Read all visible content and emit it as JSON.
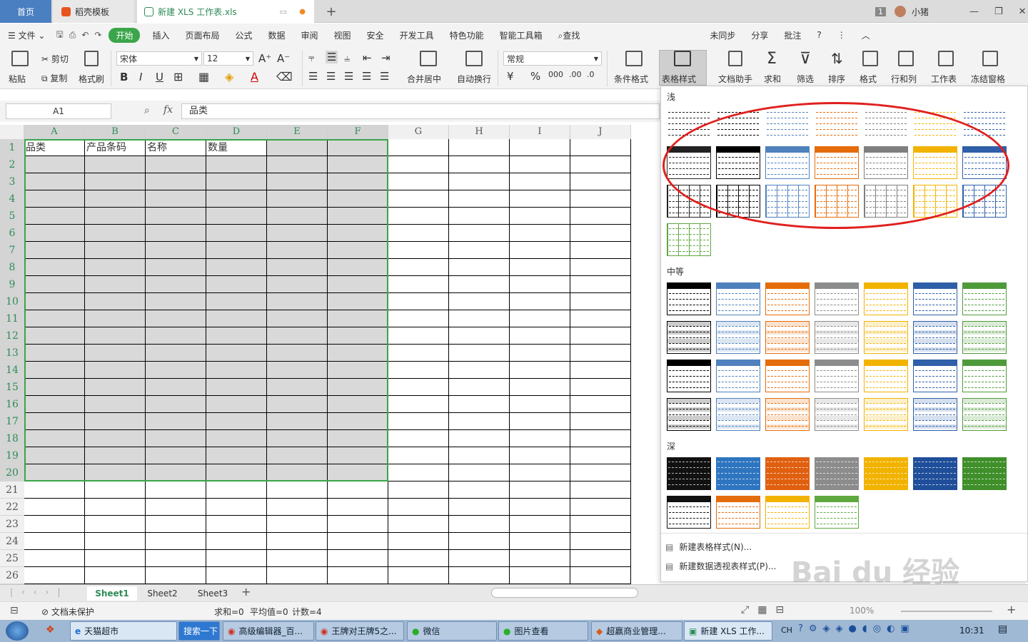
{
  "tabs": {
    "home": "首页",
    "daoke": "稻壳模板",
    "file": "新建 XLS 工作表.xls",
    "count_badge": "1",
    "user": "小猪"
  },
  "menu": {
    "file": "文件",
    "items": [
      "开始",
      "插入",
      "页面布局",
      "公式",
      "数据",
      "审阅",
      "视图",
      "安全",
      "开发工具",
      "特色功能",
      "智能工具箱"
    ],
    "search": "查找",
    "right": [
      "未同步",
      "分享",
      "批注"
    ]
  },
  "ribbon": {
    "paste": "粘贴",
    "cut": "剪切",
    "copy": "复制",
    "format_painter": "格式刷",
    "font": "宋体",
    "font_size": "12",
    "merge": "合并居中",
    "wrap": "自动换行",
    "number_format": "常规",
    "cond_format": "条件格式",
    "table_style": "表格样式",
    "doc_helper": "文档助手",
    "sum": "求和",
    "filter": "筛选",
    "sort": "排序",
    "format": "格式",
    "rowcol": "行和列",
    "sheet": "工作表",
    "freeze": "冻结窗格"
  },
  "formula": {
    "cell_ref": "A1",
    "fx": "fx",
    "content": "品类"
  },
  "grid": {
    "columns": [
      "A",
      "B",
      "C",
      "D",
      "E",
      "F",
      "G",
      "H",
      "I",
      "J"
    ],
    "rows": [
      "1",
      "2",
      "3",
      "4",
      "5",
      "6",
      "7",
      "8",
      "9",
      "10",
      "11",
      "12",
      "13",
      "14",
      "15",
      "16",
      "17",
      "18",
      "19",
      "20",
      "21",
      "22",
      "23",
      "24",
      "25",
      "26"
    ],
    "headers": [
      "品类",
      "产品条码",
      "名称",
      "数量"
    ]
  },
  "gallery": {
    "light": "浅",
    "medium": "中等",
    "dark": "深",
    "new_table_style": "新建表格样式(N)...",
    "new_pivot_style": "新建数据透视表样式(P)...",
    "light_colors": [
      "#222222",
      "#000000",
      "#4f81bd",
      "#e46c0a",
      "#7f7f7f",
      "#f2b300",
      "#2e5fa8"
    ],
    "medium_colors": [
      "#000000",
      "#4f81bd",
      "#e46c0a",
      "#8c8c8c",
      "#f2b300",
      "#2e5fa8",
      "#4e9a3a"
    ],
    "dark_colors": [
      "#111111",
      "#2e75c0",
      "#e06010",
      "#8c8c8c",
      "#f2b300",
      "#1f4e9a",
      "#3f8f2a"
    ],
    "dark_row2_colors": [
      "#111111",
      "#e46c0a",
      "#f2b300",
      "#5fa840"
    ]
  },
  "sheets": [
    "Sheet1",
    "Sheet2",
    "Sheet3"
  ],
  "status": {
    "protect": "文档未保护",
    "sum": "求和=0",
    "avg": "平均值=0",
    "count": "计数=4",
    "zoom": "100%"
  },
  "taskbar": {
    "ie": "天猫超市",
    "search": "搜索一下",
    "t1": "高级编辑器_百...",
    "t2": "王牌对王牌5之...",
    "t3": "微信",
    "t4": "图片查看",
    "t5": "超赢商业管理...",
    "t6": "新建 XLS 工作...",
    "lang": "CH",
    "time": "10:31"
  },
  "watermark": "Bai du 经验"
}
